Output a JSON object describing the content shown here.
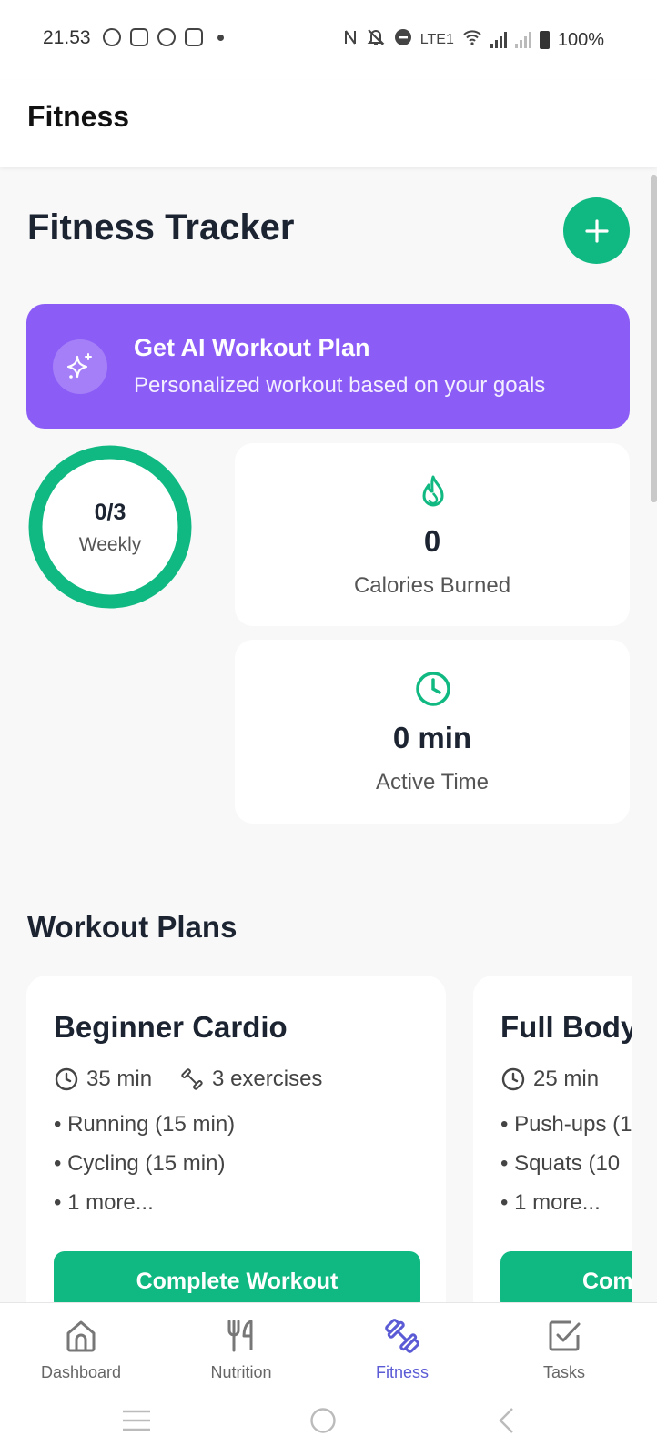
{
  "status_bar": {
    "time": "21.53",
    "battery": "100%",
    "left_icons": [
      "whatsapp-icon",
      "discord-icon",
      "spotify-icon",
      "app-icon"
    ],
    "right_icons": [
      "nfc-icon",
      "mute-icon",
      "dnd-icon",
      "volte-icon",
      "wifi-icon",
      "signal-icon",
      "signal-icon",
      "battery-icon"
    ],
    "volte_text": "LTE1"
  },
  "app_bar": {
    "title": "Fitness"
  },
  "header": {
    "title": "Fitness Tracker",
    "add_icon": "plus-icon"
  },
  "ai_banner": {
    "title": "Get AI Workout Plan",
    "subtitle": "Personalized workout based on your goals",
    "icon": "sparkles-icon"
  },
  "weekly_progress": {
    "value": "0/3",
    "label": "Weekly",
    "completed": 0,
    "goal": 3
  },
  "stats": [
    {
      "icon": "flame-icon",
      "value": "0",
      "label": "Calories Burned"
    },
    {
      "icon": "clock-icon",
      "value": "0 min",
      "label": "Active Time"
    }
  ],
  "workout_plans": {
    "title": "Workout Plans",
    "plans": [
      {
        "name": "Beginner Cardio",
        "duration": "35 min",
        "exercise_count": "3 exercises",
        "exercises": [
          "• Running (15 min)",
          "• Cycling (15 min)",
          "• 1 more..."
        ],
        "button_label": "Complete Workout"
      },
      {
        "name": "Full Body",
        "duration": "25 min",
        "exercises": [
          "• Push-ups (1",
          "• Squats (10",
          "• 1 more..."
        ],
        "button_label": "Com"
      }
    ]
  },
  "bottom_nav": {
    "items": [
      {
        "label": "Dashboard",
        "icon": "home-icon"
      },
      {
        "label": "Nutrition",
        "icon": "fork-knife-icon"
      },
      {
        "label": "Fitness",
        "icon": "dumbbell-icon",
        "active": true
      },
      {
        "label": "Tasks",
        "icon": "checkbox-icon"
      }
    ]
  },
  "colors": {
    "accent_green": "#10b981",
    "ai_purple": "#8b5cf6",
    "active_nav": "#5b5bd6",
    "text_dark": "#1c2432",
    "background": "#f8f8f9"
  }
}
